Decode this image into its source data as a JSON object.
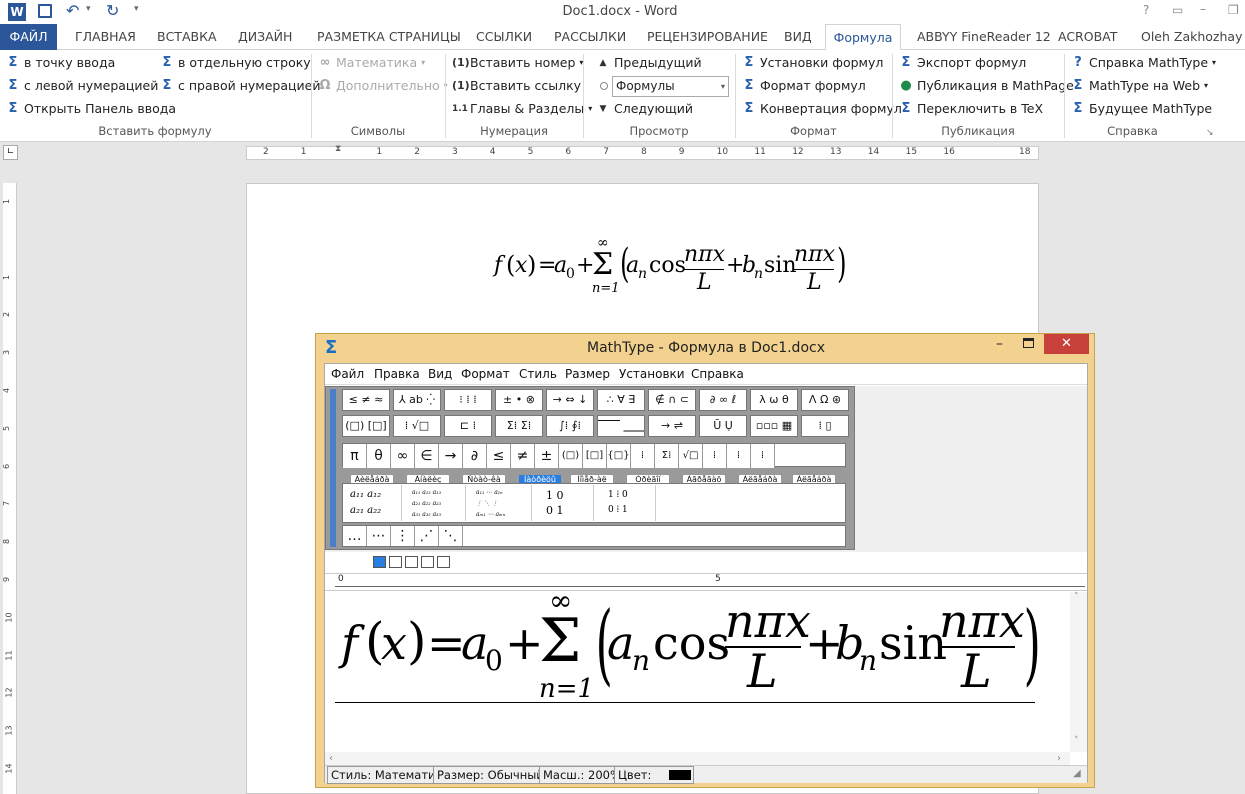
{
  "window": {
    "title": "Doc1.docx - Word"
  },
  "qat": {
    "save_icon": "save-icon",
    "undo_icon": "undo-icon",
    "redo_icon": "redo-icon"
  },
  "tabs": [
    {
      "label": "ФАЙЛ"
    },
    {
      "label": "ГЛАВНАЯ"
    },
    {
      "label": "ВСТАВКА"
    },
    {
      "label": "ДИЗАЙН"
    },
    {
      "label": "РАЗМЕТКА СТРАНИЦЫ"
    },
    {
      "label": "ССЫЛКИ"
    },
    {
      "label": "РАССЫЛКИ"
    },
    {
      "label": "РЕЦЕНЗИРОВАНИЕ"
    },
    {
      "label": "ВИД"
    },
    {
      "label": "Формула"
    },
    {
      "label": "ABBYY FineReader 12"
    },
    {
      "label": "ACROBAT"
    }
  ],
  "user": {
    "name": "Oleh Zakhozhay"
  },
  "ribbon": {
    "insert_group": {
      "label": "Вставить формулу",
      "items": [
        {
          "label": "в точку ввода"
        },
        {
          "label": "с левой нумерацией"
        },
        {
          "label": "Открыть Панель ввода"
        },
        {
          "label": "в отдельную строку"
        },
        {
          "label": "с правой нумерацией"
        }
      ]
    },
    "symbols_group": {
      "label": "Символы",
      "items": [
        {
          "label": "Математика"
        },
        {
          "label": "Дополнительно"
        }
      ]
    },
    "numbering_group": {
      "label": "Нумерация",
      "items": [
        {
          "label": "Вставить номер"
        },
        {
          "label": "Вставить ссылку"
        },
        {
          "label": "Главы & Разделы"
        }
      ]
    },
    "view_group": {
      "label": "Просмотр",
      "items": [
        {
          "label": "Предыдущий"
        },
        {
          "label": "Следующий"
        }
      ],
      "select_value": "Формулы"
    },
    "format_group": {
      "label": "Формат",
      "items": [
        {
          "label": "Установки формул"
        },
        {
          "label": "Формат формул"
        },
        {
          "label": "Конвертация формул"
        }
      ]
    },
    "publish_group": {
      "label": "Публикация",
      "items": [
        {
          "label": "Экспорт формул"
        },
        {
          "label": "Публикация в MathPage"
        },
        {
          "label": "Переключить в TeX"
        }
      ]
    },
    "help_group": {
      "label": "Справка",
      "items": [
        {
          "label": "Справка MathType"
        },
        {
          "label": "MathType на Web"
        },
        {
          "label": "Будущее MathType"
        }
      ]
    }
  },
  "ruler": {
    "labels": [
      "2",
      "1",
      "",
      "1",
      "2",
      "3",
      "4",
      "5",
      "6",
      "7",
      "8",
      "9",
      "10",
      "11",
      "12",
      "13",
      "14",
      "15",
      "16",
      "",
      "18"
    ]
  },
  "vruler": {
    "labels": [
      "1",
      "",
      "1",
      "2",
      "3",
      "4",
      "5",
      "6",
      "7",
      "8",
      "9",
      "10",
      "11",
      "12",
      "13",
      "14"
    ]
  },
  "doc": {
    "eq": {
      "f": "f",
      "x": "x",
      "eq": "=",
      "a0": "a",
      "sub0": "0",
      "plus": "+",
      "sigma": "Σ",
      "inf": "∞",
      "n1": "n=1",
      "an": "a",
      "subn": "n",
      "cos": "cos",
      "npix": "nπx",
      "L": "L",
      "bn": "b",
      "sin": "sin"
    }
  },
  "mathtype": {
    "title": "MathType - Формула в Doc1.docx",
    "menu": [
      "Файл",
      "Правка",
      "Вид",
      "Формат",
      "Стиль",
      "Размер",
      "Установки",
      "Справка"
    ],
    "palette_row1": [
      "≤ ≠ ≈",
      "⅄ ab ⁛",
      "⁝ ⁞ ⁞",
      "± • ⊗",
      "→ ⇔ ↓",
      "∴ ∀ ∃",
      "∉ ∩ ⊂",
      "∂ ∞ ℓ",
      "λ ω θ",
      "Λ Ω ⊛"
    ],
    "palette_row2": [
      "(□) [□]",
      "⁞ √□",
      "⊏ ⁞",
      "Σ⁞ Σ⁞",
      "∫⁞ ∮⁞",
      "⎺⎺ ⎽⎽",
      "→ ⇌",
      "Ū Ụ",
      "▫▫▫ ▦",
      "⁞ ▯"
    ],
    "sym_row": [
      "π",
      "θ",
      "∞",
      "∈",
      "→",
      "∂",
      "≤",
      "≠",
      "±",
      "(□)",
      "[□]",
      "{□}",
      "⁞",
      "Σ⁞",
      "√□",
      "⁞",
      "⁞",
      "⁞"
    ],
    "tabs": [
      "Àèëåáðà",
      "Àíàëèç",
      "Ñòàò-êà",
      "Ìàòðèöû",
      "Íîìåð-àë",
      "Òðèãîí",
      "Àãðåãàö",
      "Àëãåáðà",
      "Àëãåáðà"
    ],
    "dots": [
      "…",
      "⋯",
      "⋮",
      "⋰",
      "⋱"
    ],
    "ruler_labels": [
      "0",
      "5"
    ],
    "status": {
      "style": "Стиль: Математика",
      "size": "Размер: Обычный",
      "zoom": "Масш.: 200%",
      "color": "Цвет:"
    }
  }
}
